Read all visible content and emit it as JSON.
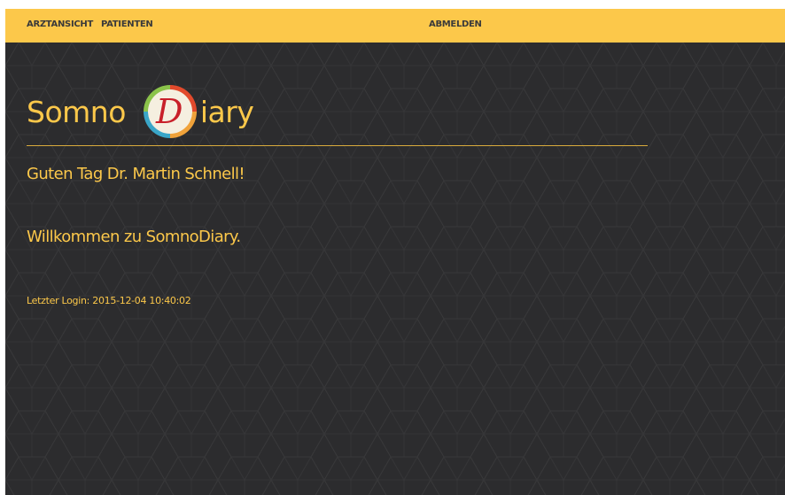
{
  "nav": {
    "arztansicht_label": "ARZTANSICHT",
    "patienten_label": "PATIENTEN",
    "abmelden_label": "ABMELDEN"
  },
  "brand": {
    "name_part1": "Somno",
    "logo_letter": "D",
    "name_part2": "iary"
  },
  "main": {
    "greeting": "Guten Tag Dr. Martin Schnell!",
    "welcome": "Willkommen zu SomnoDiary.",
    "last_login_label": "Letzter Login:",
    "last_login_value": "2015-12-04 10:40:02"
  },
  "colors": {
    "navbar_bg": "#fcc84a",
    "page_bg": "#2c2c2e",
    "accent_text": "#fcc84a"
  }
}
